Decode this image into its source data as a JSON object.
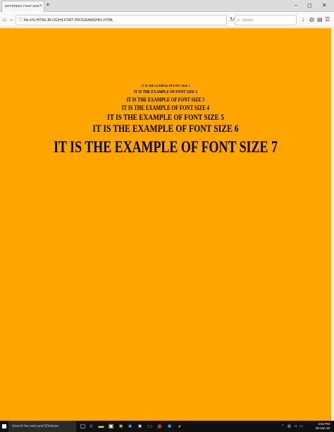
{
  "browser": {
    "tab_title": "DIFFERENT FONT SIZE",
    "tab_close": "×",
    "new_tab": "+",
    "url": "file:///G:/HTML-BLOG/H4 FONT PROGRAMS/H41.HTML",
    "search_placeholder": "Search",
    "window_controls": {
      "minimize": "–",
      "restore": "◻",
      "close": "✕"
    }
  },
  "page": {
    "background_color": "#ffa500",
    "headings": [
      "IT IS THE EXAMPLE OF FONT SIZE 1",
      "IT IS THE EXAMPLE OF FONT SIZE 2",
      "IT IS THE EXAMPLE OF FONT SIZE 3",
      "IT IS THE EXAMPLE OF FONT SIZE 4",
      "IT IS THE EXAMPLE OF FONT SIZE 5",
      "IT IS THE EXAMPLE OF FONT SIZE 6",
      "IT IS THE EXAMPLE OF FONT SIZE 7"
    ]
  },
  "taskbar": {
    "search_placeholder": "Search the web and Windows",
    "clock_time": "3:04 PM",
    "clock_date": "28-Jun-16",
    "icons": [
      "task-view-icon",
      "edge-icon",
      "file-explorer-icon",
      "store-icon",
      "app-icon",
      "app-icon",
      "app-icon",
      "app-icon",
      "chrome-icon",
      "app-icon",
      "firefox-icon"
    ]
  }
}
